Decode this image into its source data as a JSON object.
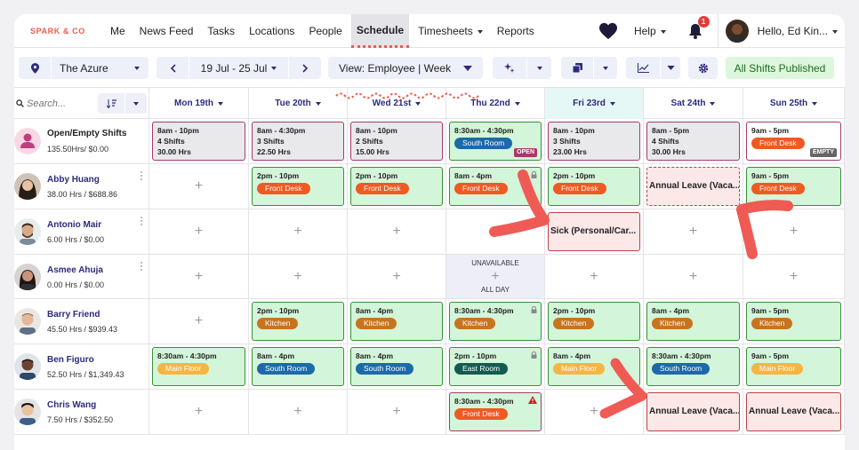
{
  "brand": "SPARK & CO",
  "nav": {
    "links": [
      "Me",
      "News Feed",
      "Tasks",
      "Locations",
      "People",
      "Schedule",
      "Timesheets",
      "Reports"
    ],
    "active": "Schedule",
    "help_label": "Help",
    "notification_count": "1",
    "greeting": "Hello, Ed Kin..."
  },
  "toolbar": {
    "location": "The Azure",
    "date_range": "19 Jul - 25 Jul",
    "view": "View: Employee | Week",
    "status": "All Shifts Published"
  },
  "search": {
    "placeholder": "Search..."
  },
  "days": [
    "Mon 19th",
    "Tue 20th",
    "Wed 21st",
    "Thu 22nd",
    "Fri 23rd",
    "Sat 24th",
    "Sun 25th"
  ],
  "today_index": 4,
  "colors": {
    "front_desk": "#ef5a24",
    "south_room": "#1d6aa8",
    "kitchen": "#c8741e",
    "main_floor": "#f5b544",
    "east_room": "#145a52",
    "accent": "#ef5a50",
    "brand_text": "#2c2a7c"
  },
  "rows": [
    {
      "name": "Open/Empty Shifts",
      "hours": "135.50Hrs/ $0.00",
      "avatar": "open",
      "cells": [
        {
          "type": "gray",
          "time": "8am - 10pm",
          "l2": "4 Shifts",
          "l3": "30.00 Hrs"
        },
        {
          "type": "gray",
          "time": "8am - 4:30pm",
          "l2": "3 Shifts",
          "l3": "22.50 Hrs"
        },
        {
          "type": "gray",
          "time": "8am - 10pm",
          "l2": "2 Shifts",
          "l3": "15.00 Hrs"
        },
        {
          "type": "shift",
          "time": "8:30am - 4:30pm",
          "area": "South Room",
          "color": "south_room",
          "tag": "OPEN"
        },
        {
          "type": "gray",
          "time": "8am - 10pm",
          "l2": "3 Shifts",
          "l3": "23.00 Hrs"
        },
        {
          "type": "gray",
          "time": "8am - 5pm",
          "l2": "4 Shifts",
          "l3": "30.00 Hrs"
        },
        {
          "type": "white",
          "time": "9am - 5pm",
          "area": "Front Desk",
          "color": "front_desk",
          "tag": "EMPTY"
        }
      ]
    },
    {
      "name": "Abby Huang",
      "hours": "38.00 Hrs / $688.86",
      "avatar": "a1",
      "cells": [
        {
          "type": "empty"
        },
        {
          "type": "shift",
          "time": "2pm - 10pm",
          "area": "Front Desk",
          "color": "front_desk"
        },
        {
          "type": "shift",
          "time": "2pm - 10pm",
          "area": "Front Desk",
          "color": "front_desk"
        },
        {
          "type": "shift",
          "time": "8am - 4pm",
          "area": "Front Desk",
          "color": "front_desk",
          "lock": true
        },
        {
          "type": "shift",
          "time": "2pm - 10pm",
          "area": "Front Desk",
          "color": "front_desk"
        },
        {
          "type": "leave-dash",
          "label": "Annual Leave (Vaca..."
        },
        {
          "type": "shift",
          "time": "9am - 5pm",
          "area": "Front Desk",
          "color": "front_desk"
        }
      ]
    },
    {
      "name": "Antonio Mair",
      "hours": "6.00 Hrs / $0.00",
      "avatar": "a2",
      "cells": [
        {
          "type": "empty"
        },
        {
          "type": "empty"
        },
        {
          "type": "empty"
        },
        {
          "type": "empty"
        },
        {
          "type": "leave",
          "label": "Sick (Personal/Car..."
        },
        {
          "type": "empty"
        },
        {
          "type": "empty"
        }
      ]
    },
    {
      "name": "Asmee Ahuja",
      "hours": "0.00 Hrs / $0.00",
      "avatar": "a3",
      "cells": [
        {
          "type": "empty"
        },
        {
          "type": "empty"
        },
        {
          "type": "empty"
        },
        {
          "type": "unavailable",
          "l1": "UNAVAILABLE",
          "l2": "ALL DAY"
        },
        {
          "type": "empty"
        },
        {
          "type": "empty"
        },
        {
          "type": "empty"
        }
      ]
    },
    {
      "name": "Barry Friend",
      "hours": "45.50 Hrs / $939.43",
      "avatar": "a4",
      "cells": [
        {
          "type": "empty"
        },
        {
          "type": "shift",
          "time": "2pm - 10pm",
          "area": "Kitchen",
          "color": "kitchen"
        },
        {
          "type": "shift",
          "time": "8am - 4pm",
          "area": "Kitchen",
          "color": "kitchen"
        },
        {
          "type": "shift",
          "time": "8:30am - 4:30pm",
          "area": "Kitchen",
          "color": "kitchen",
          "lock": true
        },
        {
          "type": "shift",
          "time": "2pm - 10pm",
          "area": "Kitchen",
          "color": "kitchen"
        },
        {
          "type": "shift",
          "time": "8am - 4pm",
          "area": "Kitchen",
          "color": "kitchen"
        },
        {
          "type": "shift",
          "time": "9am - 5pm",
          "area": "Kitchen",
          "color": "kitchen"
        }
      ]
    },
    {
      "name": "Ben Figuro",
      "hours": "52.50 Hrs / $1,349.43",
      "avatar": "a5",
      "cells": [
        {
          "type": "shift",
          "time": "8:30am - 4:30pm",
          "area": "Main Floor",
          "color": "main_floor"
        },
        {
          "type": "shift",
          "time": "8am - 4pm",
          "area": "South Room",
          "color": "south_room"
        },
        {
          "type": "shift",
          "time": "8am - 4pm",
          "area": "South Room",
          "color": "south_room"
        },
        {
          "type": "shift",
          "time": "2pm - 10pm",
          "area": "East Room",
          "color": "east_room",
          "lock": true
        },
        {
          "type": "shift",
          "time": "8am - 4pm",
          "area": "Main Floor",
          "color": "main_floor"
        },
        {
          "type": "shift",
          "time": "8:30am - 4:30pm",
          "area": "South Room",
          "color": "south_room"
        },
        {
          "type": "shift",
          "time": "9am - 5pm",
          "area": "Main Floor",
          "color": "main_floor"
        }
      ]
    },
    {
      "name": "Chris Wang",
      "hours": "7.50 Hrs / $352.50",
      "avatar": "a6",
      "cells": [
        {
          "type": "empty"
        },
        {
          "type": "empty"
        },
        {
          "type": "empty"
        },
        {
          "type": "shift-red",
          "time": "8:30am - 4:30pm",
          "area": "Front Desk",
          "color": "front_desk",
          "warn": true
        },
        {
          "type": "empty"
        },
        {
          "type": "leave",
          "label": "Annual Leave (Vaca..."
        },
        {
          "type": "leave",
          "label": "Annual Leave (Vaca..."
        }
      ]
    }
  ]
}
